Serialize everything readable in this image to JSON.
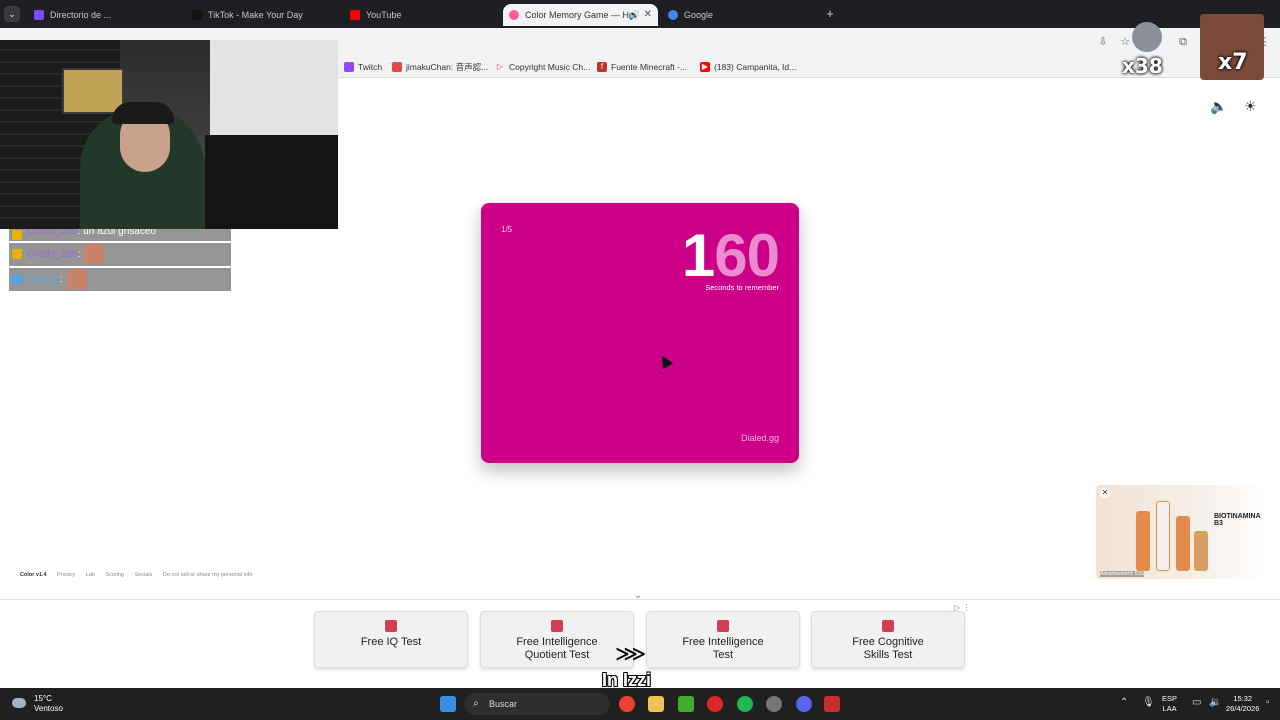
{
  "browser": {
    "tabs": [
      {
        "title": "Directorio de ...",
        "color": "#7b4cff"
      },
      {
        "title": "TikTok - Make Your Day",
        "color": "#111111"
      },
      {
        "title": "YouTube",
        "color": "#ff0000"
      },
      {
        "title": "Color Memory Game — Ho",
        "color": "#ff5a9a"
      },
      {
        "title": "Google",
        "color": "#4285f4"
      }
    ],
    "bookmarks": [
      {
        "label": "Twitch",
        "color": "#9146ff"
      },
      {
        "label": "jimakuChan: 音声認...",
        "color": "#e04a4a"
      },
      {
        "label": "Copyright Music Ch...",
        "color": "#d83a3a"
      },
      {
        "label": "Fuente Minecraft -...",
        "color": "#c4302b"
      },
      {
        "label": "(183) Campanita, Id...",
        "color": "#ff0000"
      }
    ]
  },
  "game": {
    "round": "1/5",
    "timer_digit_1": "1",
    "timer_digits_rest": "60",
    "timer_label": "Seconds to remember",
    "brand": "Dialed.gg",
    "card_color": "#cc0088"
  },
  "footer": {
    "version": "Color v1.4",
    "links": [
      "Privacy",
      "Lab",
      "Scoring",
      "Socials",
      "Do not sell or share my personal info"
    ]
  },
  "ads": {
    "buttons": [
      "Free IQ Test",
      "Free Intelligence Quotient Test",
      "Free Intelligence Test",
      "Free Cognitive Skills Test"
    ],
    "video_title": "BIOTINAMINA B3",
    "video_label": "Advertisement: 0:51"
  },
  "stream": {
    "chat": [
      {
        "user": "Cristhi_200",
        "message": ": un azul grisaceo"
      },
      {
        "user": "Cristhi_200",
        "message": ":"
      },
      {
        "user": "lawtyyy",
        "message": ":"
      }
    ],
    "count_cat": "x38",
    "count_face": "x7",
    "caption": "In Izzi",
    "arrow": "⋙"
  },
  "taskbar": {
    "temperature": "15°C",
    "weather": "Ventoso",
    "search_placeholder": "Buscar",
    "lang_top": "ESP",
    "lang_bottom": "LAA",
    "time": "15:32",
    "date": "26/4/2026"
  }
}
